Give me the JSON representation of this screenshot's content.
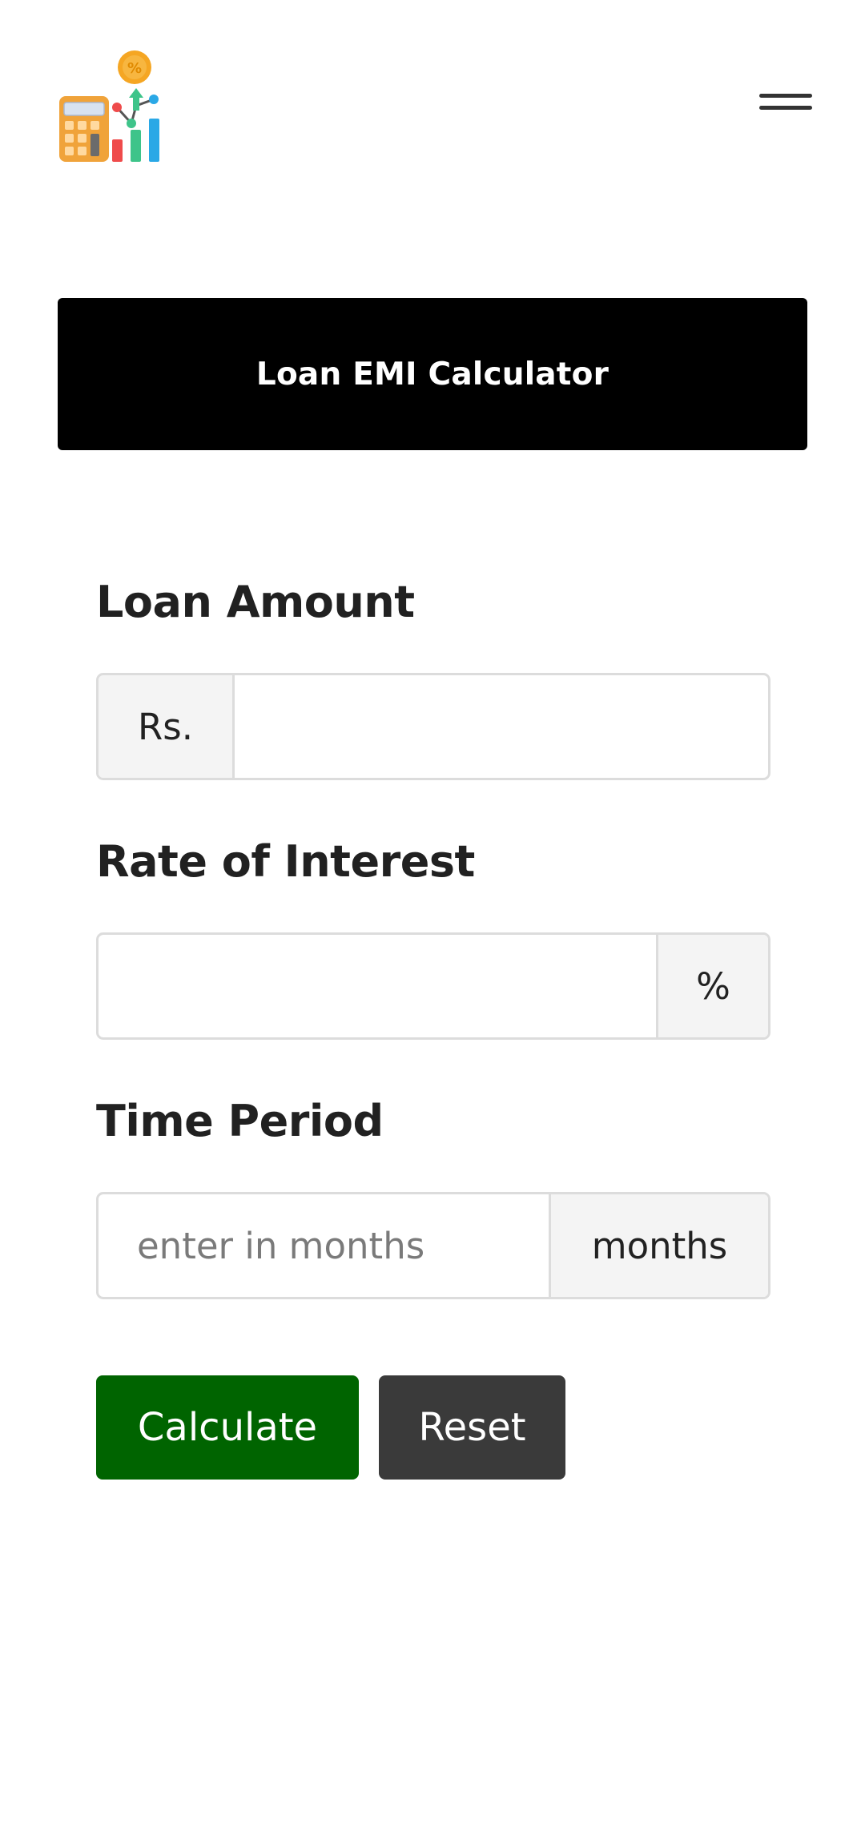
{
  "navbar": {
    "logo_icon": "calculator-chart-percent-icon",
    "menu_icon": "hamburger-menu-icon"
  },
  "banner": {
    "title": "Loan EMI Calculator"
  },
  "form": {
    "loan_amount": {
      "label": "Loan Amount",
      "prefix": "Rs.",
      "value": "",
      "placeholder": ""
    },
    "rate_of_interest": {
      "label": "Rate of Interest",
      "suffix": "%",
      "value": "",
      "placeholder": ""
    },
    "time_period": {
      "label": "Time Period",
      "suffix": "months",
      "value": "",
      "placeholder": "enter in months"
    }
  },
  "buttons": {
    "calculate": "Calculate",
    "reset": "Reset"
  },
  "colors": {
    "banner_bg": "#000000",
    "calculate_bg": "#006400",
    "reset_bg": "#3a3a3a"
  }
}
